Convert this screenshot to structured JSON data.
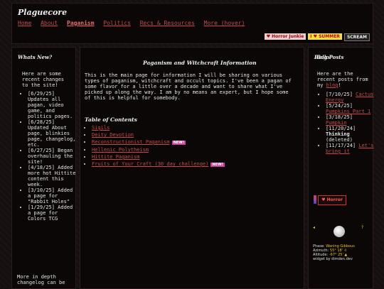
{
  "site": {
    "title": "Plaguecore",
    "nav": [
      "Home",
      "About",
      "Paganism",
      "Politics",
      "Recs & Resources",
      "More (hover)"
    ],
    "badges": [
      "♥ Horror Junkie",
      "I ♥ SUMMER",
      "SCREAM"
    ]
  },
  "left": {
    "title": "Whats New?",
    "intro": "Here are some recent changes to the site!",
    "updates": [
      "[6/29/25] Updates all pagan, video game, and politics pages.",
      "[6/28/25] Updated About page, blinkies page, changelog, etc.",
      "[6/27/25] Began overhauling the site!",
      "[4/18/25] Added more hot Hittite content this week.",
      "[3/10/25] Added a page for \"Rabbit Holes\"",
      "[1/29/25] Added a page for Colors TCG"
    ],
    "more": "More in depth changelog can be"
  },
  "main": {
    "title": "Paganism and Witchcraft Information",
    "intro": "This is the main page for information I will be sharing on various types of paganism, witchcraft and occult topics. I've been a pagan of some flavor for a little over a decade and want to share what I've picked up along the way. I am by no means an expert, but I hope some of this is helpful for somebody.",
    "toc_title": "Table of Contents",
    "toc": [
      "Sigils",
      "Deity Devotion",
      "Reconstructionist Paganism",
      "Hellenic Polytheism",
      "Hittite Paganism",
      "Fruits of Your Craft (30 day challenge)"
    ],
    "new_label": "NEW!"
  },
  "right": {
    "title": "Blog Posts",
    "intro_pre": "Here are the recent posts from my ",
    "intro_link": "blog",
    "intro_post": "!",
    "posts": [
      {
        "date": "[7/10/25]",
        "title": "Cactus Energy"
      },
      {
        "date": "[5/24/25]",
        "title": "Pumpkins Part 1"
      },
      {
        "date": "[3/18/25]",
        "title": "Pumpkin"
      },
      {
        "date": "[11/20/24]",
        "title": "Thinking",
        "note": "(deleted)"
      },
      {
        "date": "[11/17/24]",
        "title": "Let's bring it"
      }
    ],
    "hello": "Hello!",
    "horror_badge": "♥ Horror",
    "moon": {
      "phase_label": "Phase:",
      "phase": "Waning Gibbous",
      "azimuth_label": "Azimuth:",
      "azimuth": "55° 18' ♌",
      "altitude_label": "Altitude:",
      "altitude": "-67° 25' ▲",
      "credit": "widget by dimden.dev"
    }
  }
}
